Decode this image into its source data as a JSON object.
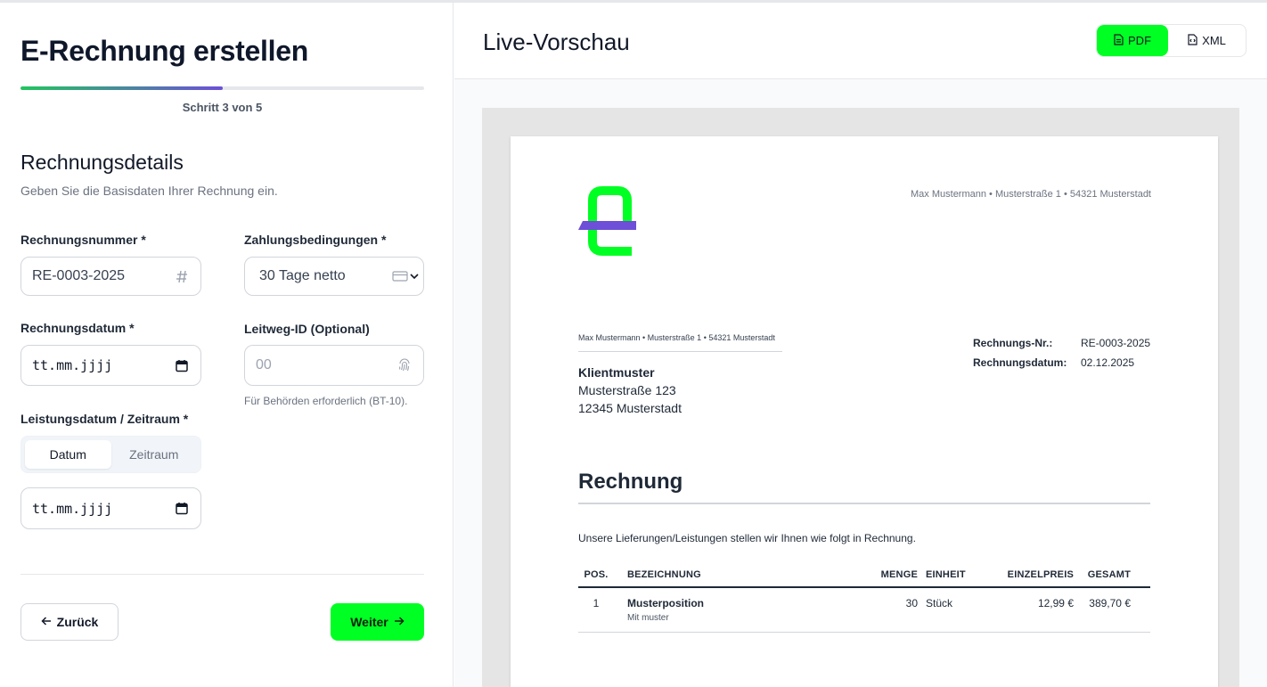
{
  "colors": {
    "accent": "#00ff22",
    "progress_start": "#22c55e",
    "progress_end": "#6d4fd8",
    "logo_green": "#00ff22",
    "logo_purple": "#6d4fd8"
  },
  "form": {
    "title": "E-Rechnung erstellen",
    "progress": {
      "current_step": 3,
      "total_steps": 5,
      "fraction": 0.5,
      "label": "Schritt 3 von 5"
    },
    "section_title": "Rechnungsdetails",
    "section_subtitle": "Geben Sie die Basisdaten Ihrer Rechnung ein.",
    "invoice_number": {
      "label": "Rechnungsnummer *",
      "value": "RE-0003-2025",
      "icon": "hash-icon"
    },
    "payment_terms": {
      "label": "Zahlungsbedingungen *",
      "value": "30 Tage netto",
      "icon": "credit-card-icon"
    },
    "invoice_date": {
      "label": "Rechnungsdatum *",
      "placeholder": "tt.mm.jjjj",
      "icon": "calendar-icon"
    },
    "leitweg_id": {
      "label": "Leitweg-ID (Optional)",
      "placeholder": "00",
      "hint": "Für Behörden erforderlich (BT-10).",
      "icon": "fingerprint-icon"
    },
    "service_date": {
      "label": "Leistungsdatum / Zeitraum *",
      "tabs": [
        {
          "label": "Datum",
          "active": true
        },
        {
          "label": "Zeitraum",
          "active": false
        }
      ],
      "placeholder": "tt.mm.jjjj"
    },
    "back_label": "Zurück",
    "next_label": "Weiter"
  },
  "preview": {
    "title": "Live-Vorschau",
    "format_tabs": [
      {
        "label": "PDF",
        "active": true,
        "icon": "file-text-icon"
      },
      {
        "label": "XML",
        "active": false,
        "icon": "file-code-icon"
      }
    ],
    "invoice": {
      "sender_line": "Max Mustermann • Musterstraße 1 • 54321 Musterstadt",
      "recipient": {
        "name": "Klientmuster",
        "street": "Musterstraße 123",
        "city": "12345 Musterstadt"
      },
      "meta": [
        {
          "key": "Rechnungs-Nr.:",
          "value": "RE-0003-2025"
        },
        {
          "key": "Rechnungsdatum:",
          "value": "02.12.2025"
        }
      ],
      "heading": "Rechnung",
      "intro": "Unsere Lieferungen/Leistungen stellen wir Ihnen wie folgt in Rechnung.",
      "columns": {
        "pos": "POS.",
        "bez": "BEZEICHNUNG",
        "menge": "MENGE",
        "einheit": "EINHEIT",
        "einzelpreis": "EINZELPREIS",
        "gesamt": "GESAMT"
      },
      "items": [
        {
          "pos": "1",
          "name": "Musterposition",
          "desc": "Mit muster",
          "menge": "30",
          "einheit": "Stück",
          "einzelpreis": "12,99 €",
          "gesamt": "389,70 €"
        }
      ]
    }
  }
}
